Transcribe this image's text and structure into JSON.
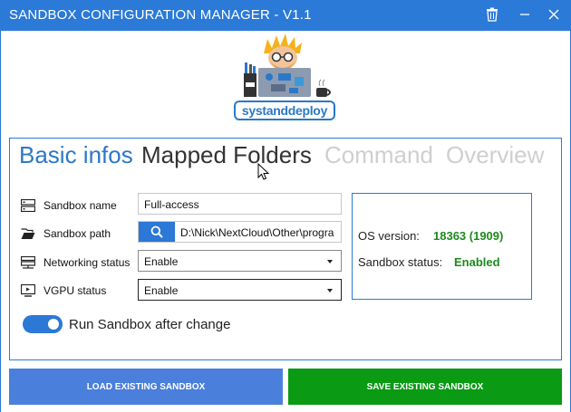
{
  "window": {
    "title": "SANDBOX CONFIGURATION MANAGER - V1.1"
  },
  "logo": {
    "text": "systanddeploy"
  },
  "tabs": [
    {
      "label": "Basic infos",
      "state": "active"
    },
    {
      "label": "Mapped Folders",
      "state": "hover"
    },
    {
      "label": "Command",
      "state": "disabled"
    },
    {
      "label": "Overview",
      "state": "disabled"
    }
  ],
  "form": {
    "name": {
      "label": "Sandbox name",
      "value": "Full-access"
    },
    "path": {
      "label": "Sandbox path",
      "value": "D:\\Nick\\NextCloud\\Other\\progra"
    },
    "networking": {
      "label": "Networking status",
      "value": "Enable"
    },
    "vgpu": {
      "label": "VGPU status",
      "value": "Enable"
    }
  },
  "info": {
    "os_label": "OS version:",
    "os_value": "18363 (1909)",
    "status_label": "Sandbox status:",
    "status_value": "Enabled"
  },
  "toggle": {
    "label": "Run Sandbox after change",
    "on": true
  },
  "buttons": {
    "load": "LOAD EXISTING SANDBOX",
    "save": "SAVE EXISTING SANDBOX"
  },
  "colors": {
    "accent": "#2b7ad7",
    "success": "#0a9a14",
    "load": "#4a7fdb"
  }
}
